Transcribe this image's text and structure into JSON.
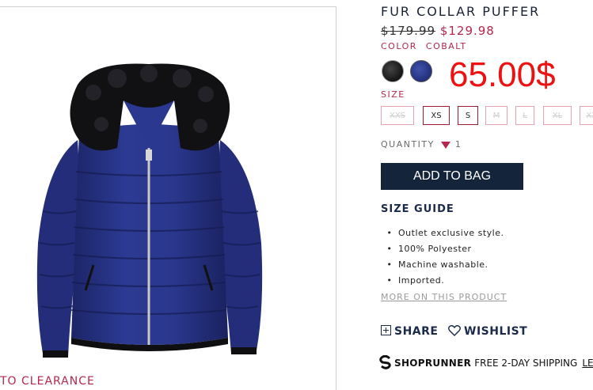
{
  "product": {
    "title": "FUR COLLAR PUFFER",
    "old_price": "$179.99",
    "new_price": "$129.98",
    "overlay_price": "65.00$",
    "color_label": "COLOR",
    "color_value": "COBALT",
    "swatches": [
      "black",
      "cobalt"
    ]
  },
  "sizes": {
    "label": "SIZE",
    "options": [
      {
        "label": "XXS",
        "available": false
      },
      {
        "label": "XS",
        "available": true
      },
      {
        "label": "S",
        "available": true
      },
      {
        "label": "M",
        "available": false
      },
      {
        "label": "L",
        "available": false
      },
      {
        "label": "XL",
        "available": false
      },
      {
        "label": "XXL",
        "available": false
      }
    ]
  },
  "quantity": {
    "label": "QUANTITY",
    "value": "1"
  },
  "actions": {
    "add_to_bag": "ADD TO BAG",
    "size_guide": "SIZE GUIDE",
    "share": "SHARE",
    "wishlist": "WISHLIST"
  },
  "features": [
    "Outlet exclusive style.",
    "100% Polyester",
    "Machine washable.",
    "Imported."
  ],
  "more_link": "MORE ON THIS PRODUCT",
  "shoprunner": {
    "name": "SHOPRUNNER",
    "text": "FREE 2-DAY SHIPPING",
    "link": "LE"
  },
  "back_link": "TO CLEARANCE",
  "colors": {
    "accent": "#b5274c",
    "navy_button": "#14243a",
    "overlay_red": "#ee1111",
    "cobalt": "#263483"
  }
}
